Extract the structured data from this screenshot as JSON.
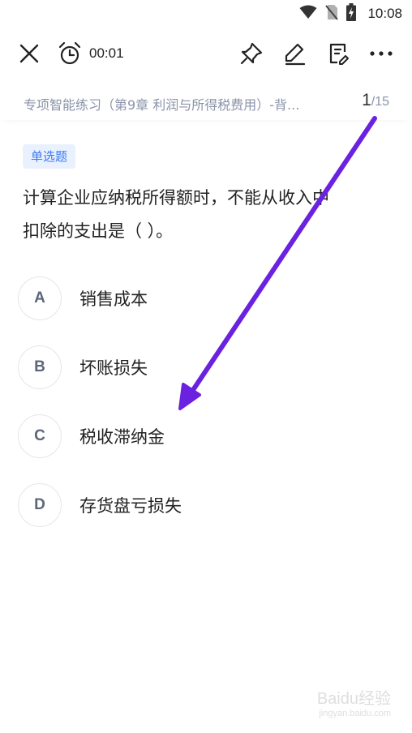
{
  "status_bar": {
    "time": "10:08",
    "icons": [
      "wifi-icon",
      "no-sim-icon",
      "battery-charging-icon"
    ]
  },
  "toolbar": {
    "timer": "00:01",
    "icons": [
      "close-icon",
      "alarm-clock-icon",
      "pin-icon",
      "pencil-icon",
      "note-edit-icon",
      "more-icon"
    ]
  },
  "practice": {
    "title": "专项智能练习（第9章 利润与所得税费用）-背...",
    "page_current": "1",
    "page_total": "/15"
  },
  "question": {
    "type_badge": "单选题",
    "stem_line1": "计算企业应纳税所得额时，不能从收入中",
    "stem_line2": "扣除的支出是（ ）。",
    "options": [
      {
        "letter": "A",
        "text": "销售成本"
      },
      {
        "letter": "B",
        "text": "坏账损失"
      },
      {
        "letter": "C",
        "text": "税收滞纳金"
      },
      {
        "letter": "D",
        "text": "存货盘亏损失"
      }
    ]
  },
  "annotation": {
    "arrow_color": "#6a22e0"
  },
  "watermark": {
    "line1": "Baidu经验",
    "line2": "jingyan.baidu.com"
  }
}
